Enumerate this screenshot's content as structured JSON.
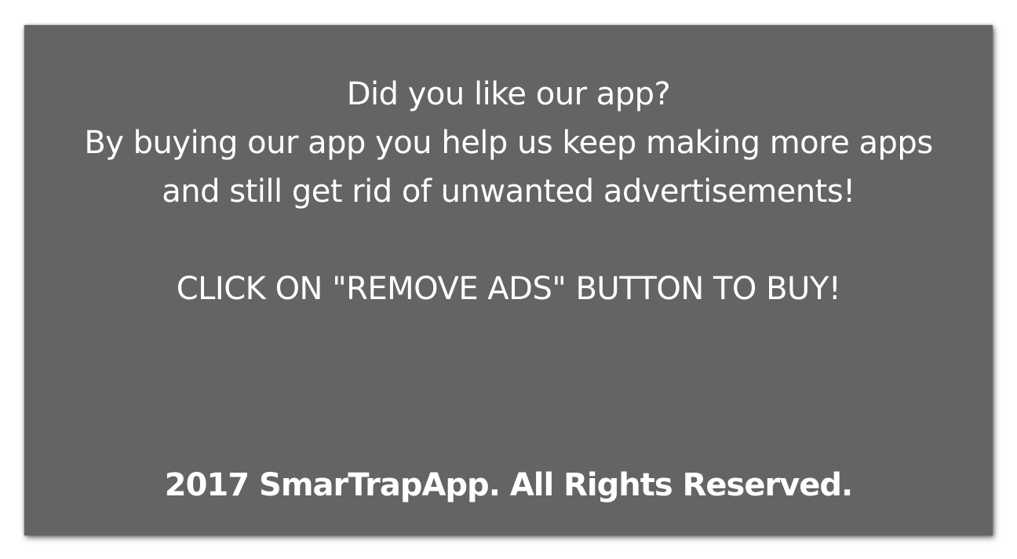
{
  "dialog": {
    "lines": [
      "Did you like our app?",
      "By buying our app you help us keep making more apps",
      "and still get rid of unwanted advertisements!"
    ],
    "cta": "CLICK ON \"REMOVE ADS\" BUTTON TO BUY!",
    "footer": "2017 SmarTrapApp. All Rights Reserved."
  },
  "colors": {
    "panel_background": "#646464",
    "text": "#ffffff",
    "page_background": "#ffffff"
  }
}
